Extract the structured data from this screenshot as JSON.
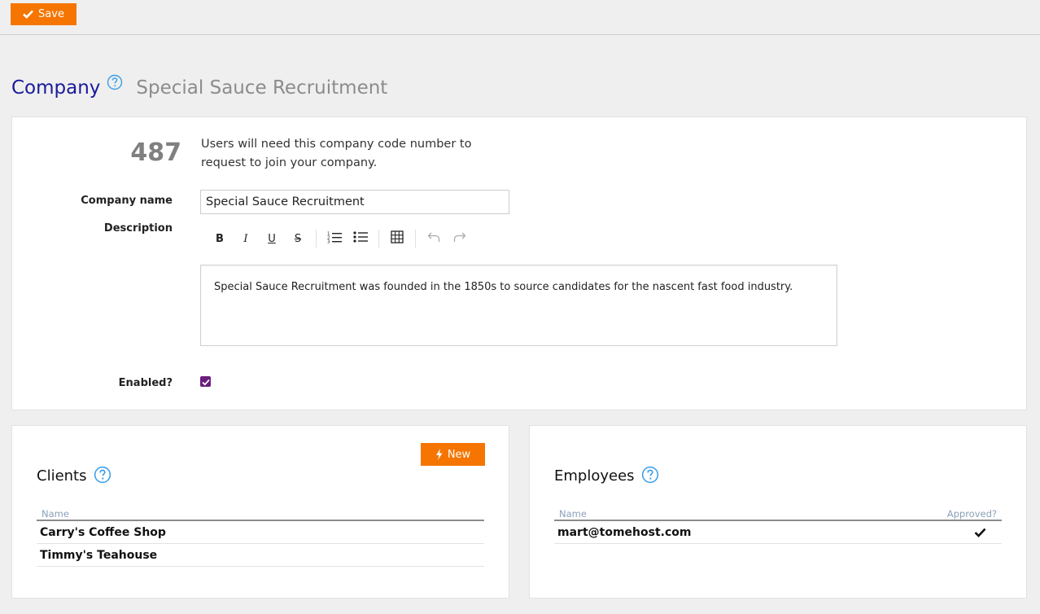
{
  "toolbar": {
    "save_label": "Save"
  },
  "header": {
    "title": "Company",
    "subtitle": "Special Sauce Recruitment"
  },
  "company": {
    "code": "487",
    "code_description": "Users will need this company code number to request to join your company.",
    "name_label": "Company name",
    "name_value": "Special Sauce Recruitment",
    "description_label": "Description",
    "description_text": "Special Sauce Recruitment was founded in the 1850s to source candidates for the nascent fast food industry.",
    "enabled_label": "Enabled?",
    "enabled": true
  },
  "editor_toolbar": {
    "bold": "B",
    "italic": "I",
    "underline": "U",
    "strike": "S"
  },
  "clients": {
    "title": "Clients",
    "new_label": "New",
    "columns": [
      "Name"
    ],
    "rows": [
      {
        "name": "Carry's Coffee Shop"
      },
      {
        "name": "Timmy's Teahouse"
      }
    ]
  },
  "employees": {
    "title": "Employees",
    "columns": [
      "Name",
      "Approved?"
    ],
    "rows": [
      {
        "name": "mart@tomehost.com",
        "approved": true
      }
    ]
  },
  "colors": {
    "accent": "#f57500",
    "title": "#1a1a9a",
    "help": "#3a9ee8",
    "checkbox": "#6c1d7e"
  }
}
